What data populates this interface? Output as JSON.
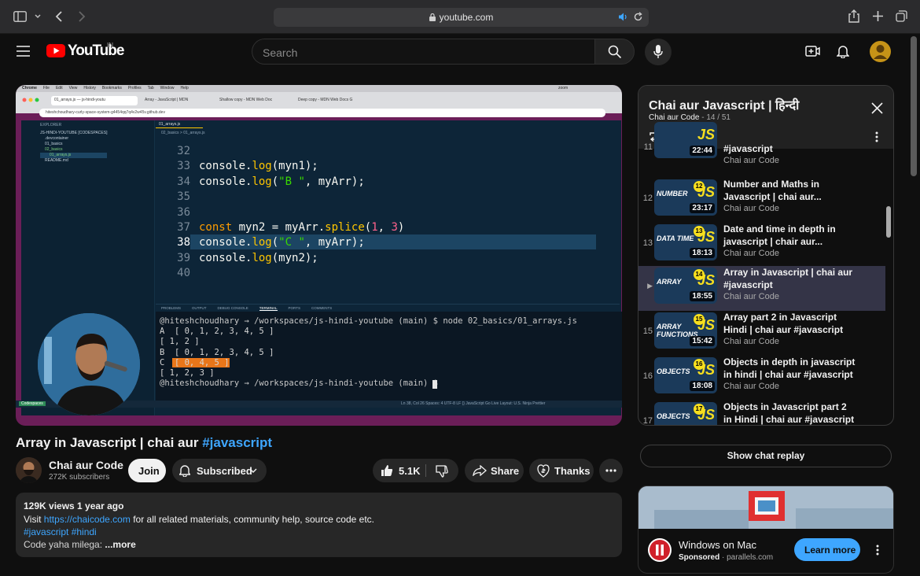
{
  "browser": {
    "url": "youtube.com"
  },
  "header": {
    "logo_text": "YouTube",
    "region": "IN",
    "search_placeholder": "Search"
  },
  "video_frame": {
    "menubar": [
      "Chrome",
      "File",
      "Edit",
      "View",
      "History",
      "Bookmarks",
      "Profiles",
      "Tab",
      "Window",
      "Help"
    ],
    "menubar_right": "zoom",
    "tabs": [
      "01_arrays.js — js-hindi-youtu",
      "Array - JavaScript | MDN",
      "Shallow copy - MDN Web Doc",
      "Deep copy - MDN Web Docs G"
    ],
    "address": "hiteshchoudhary-curly-space-system-g4454qq7q4v2w45v.github.dev",
    "explorer_title": "EXPLORER",
    "explorer_items": [
      "JS-HINDI-YOUTUBE [CODESPACES]",
      ".devcontainer",
      "01_basics",
      "02_basics",
      "01_arrays.js",
      "README.md"
    ],
    "editor_tab": "01_arrays.js",
    "breadcrumb": "02_basics > 01_arrays.js",
    "code_lines": [
      {
        "n": "32",
        "t": ""
      },
      {
        "n": "33",
        "t": "console.log(myn1);"
      },
      {
        "n": "34",
        "t": "console.log(\"B \", myArr);"
      },
      {
        "n": "35",
        "t": ""
      },
      {
        "n": "36",
        "t": ""
      },
      {
        "n": "37",
        "t": "const myn2 = myArr.splice(1, 3)"
      },
      {
        "n": "38",
        "t": "console.log(\"C \", myArr);"
      },
      {
        "n": "39",
        "t": "console.log(myn2);"
      },
      {
        "n": "40",
        "t": ""
      }
    ],
    "panel_tabs": [
      "PROBLEMS",
      "OUTPUT",
      "DEBUG CONSOLE",
      "TERMINAL",
      "PORTS",
      "COMMENTS"
    ],
    "terminal_lines": [
      "@hiteshchoudhary → /workspaces/js-hindi-youtube (main) $ node 02_basics/01_arrays.js",
      "A  [ 0, 1, 2, 3, 4, 5 ]",
      "[ 1, 2 ]",
      "B  [ 0, 1, 2, 3, 4, 5 ]",
      "C  [ 0, 4, 5 ]",
      "[ 1, 2, 3 ]",
      "@hiteshchoudhary → /workspaces/js-hindi-youtube (main) $"
    ],
    "status_left": "Codespaces",
    "status_right": "Ln 38, Col 26   Spaces: 4   UTF-8   LF   {} JavaScript   Go Live   Layout: U.S.   Ninja   Prettier"
  },
  "video": {
    "title_main": "Array in Javascript | chai aur ",
    "title_tag": "#javascript",
    "channel_name": "Chai aur Code",
    "subscribers": "272K subscribers",
    "join_label": "Join",
    "subscribed_label": "Subscribed",
    "likes": "5.1K",
    "share_label": "Share",
    "thanks_label": "Thanks"
  },
  "description": {
    "stats": "129K views  1 year ago",
    "visit_prefix": "Visit ",
    "visit_link": "https://chaicode.com",
    "visit_suffix": " for all related materials, community help, source code etc.",
    "hashtags": "#javascript #hindi",
    "line4": "Code yaha milega: ",
    "more": "...more"
  },
  "playlist": {
    "title": "Chai aur Javascript | हिन्दी",
    "channel": "Chai aur Code",
    "position": " - 14 / 51",
    "items": [
      {
        "idx": "11",
        "thumb": "",
        "num": "",
        "duration": "22:44",
        "title": "#javascript",
        "channel": "Chai aur Code"
      },
      {
        "idx": "12",
        "thumb": "NUMBER",
        "num": "12",
        "duration": "23:17",
        "title": "Number and Maths in Javascript | chai aur...",
        "channel": "Chai aur Code"
      },
      {
        "idx": "13",
        "thumb": "DATA TIME",
        "num": "13",
        "duration": "18:13",
        "title": "Date and time in depth in javascript | chair aur...",
        "channel": "Chai aur Code"
      },
      {
        "idx": "▶",
        "thumb": "ARRAY",
        "num": "14",
        "duration": "18:55",
        "title": "Array in Javascript | chai aur #javascript",
        "channel": "Chai aur Code"
      },
      {
        "idx": "15",
        "thumb": "ARRAY FUNCTIONS",
        "num": "15",
        "duration": "15:42",
        "title": "Array part 2 in Javascript Hindi | chai aur #javascript",
        "channel": "Chai aur Code"
      },
      {
        "idx": "16",
        "thumb": "OBJECTS",
        "num": "16",
        "duration": "18:08",
        "title": "Objects in depth in javascript in hindi | chai aur #javascript",
        "channel": "Chai aur Code"
      },
      {
        "idx": "17",
        "thumb": "OBJECTS",
        "num": "17",
        "duration": "",
        "title": "Objects in Javascript part 2 in Hindi | chai aur #javascript",
        "channel": ""
      }
    ]
  },
  "sidebar": {
    "chat_replay": "Show chat replay",
    "ad_title": "Windows on Mac",
    "ad_sponsored": "Sponsored",
    "ad_domain": " · parallels.com",
    "ad_cta": "Learn more"
  },
  "colors": {
    "yt_red": "#ff0000",
    "link_blue": "#3ea6ff",
    "active_row": "#343447",
    "js_yellow": "#f7df1e"
  }
}
